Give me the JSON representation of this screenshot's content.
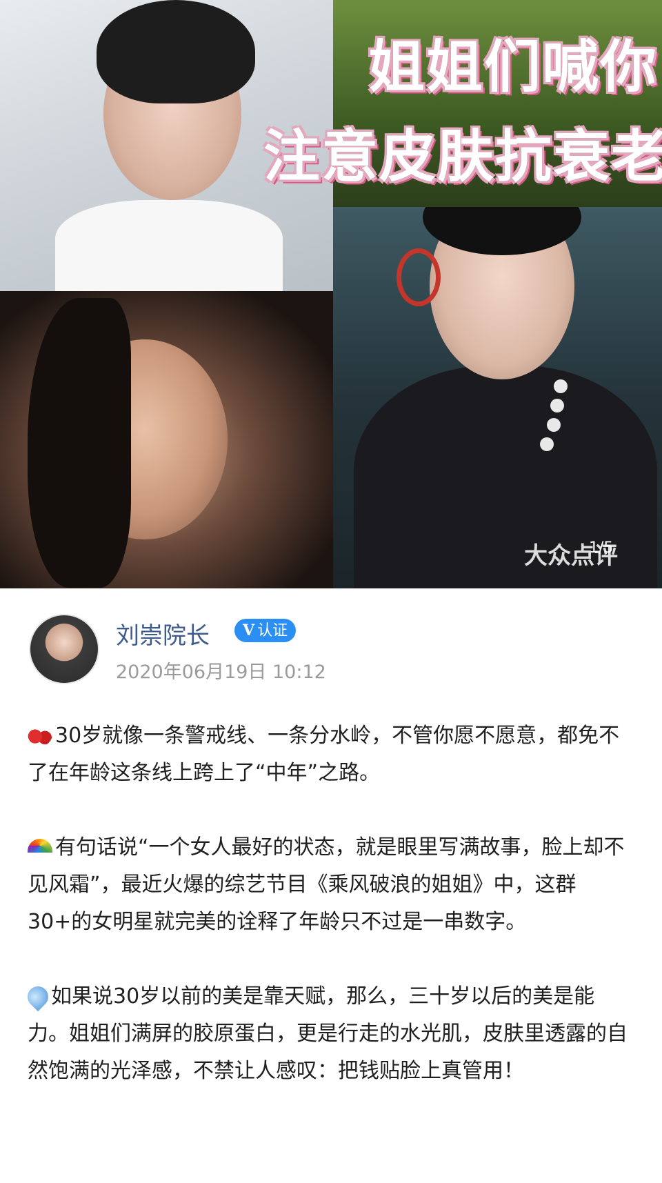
{
  "hero": {
    "headline_line1": "姐姐们喊你",
    "headline_line2": "注意皮肤抗衰老",
    "watermark": "大众点评",
    "counter": "1/5"
  },
  "post": {
    "author_name": "刘崇院长",
    "verified_label": "认证",
    "verified_prefix": "V",
    "date": "2020年06月19日 10:12",
    "paragraphs": [
      "30岁就像一条警戒线、一条分水岭，不管你愿不愿意，都免不了在年龄这条线上跨上了“中年”之路。",
      "有句话说“一个女人最好的状态，就是眼里写满故事，脸上却不见风霜”，最近火爆的综艺节目《乘风破浪的姐姐》中，这群30+的女明星就完美的诠释了年龄只不过是一串数字。",
      "如果说30岁以前的美是靠天赋，那么，三十岁以后的美是能力。姐姐们满屏的胶原蛋白，更是行走的水光肌，皮肤里透露的自然饱满的光泽感，不禁让人感叹：把钱贴脸上真管用！"
    ],
    "icons": [
      "cherry-icon",
      "rainbow-icon",
      "droplet-icon"
    ]
  },
  "colors": {
    "author_name": "#3c5a8c",
    "verified_badge": "#2a8ef2",
    "date": "#9a9a9a"
  }
}
